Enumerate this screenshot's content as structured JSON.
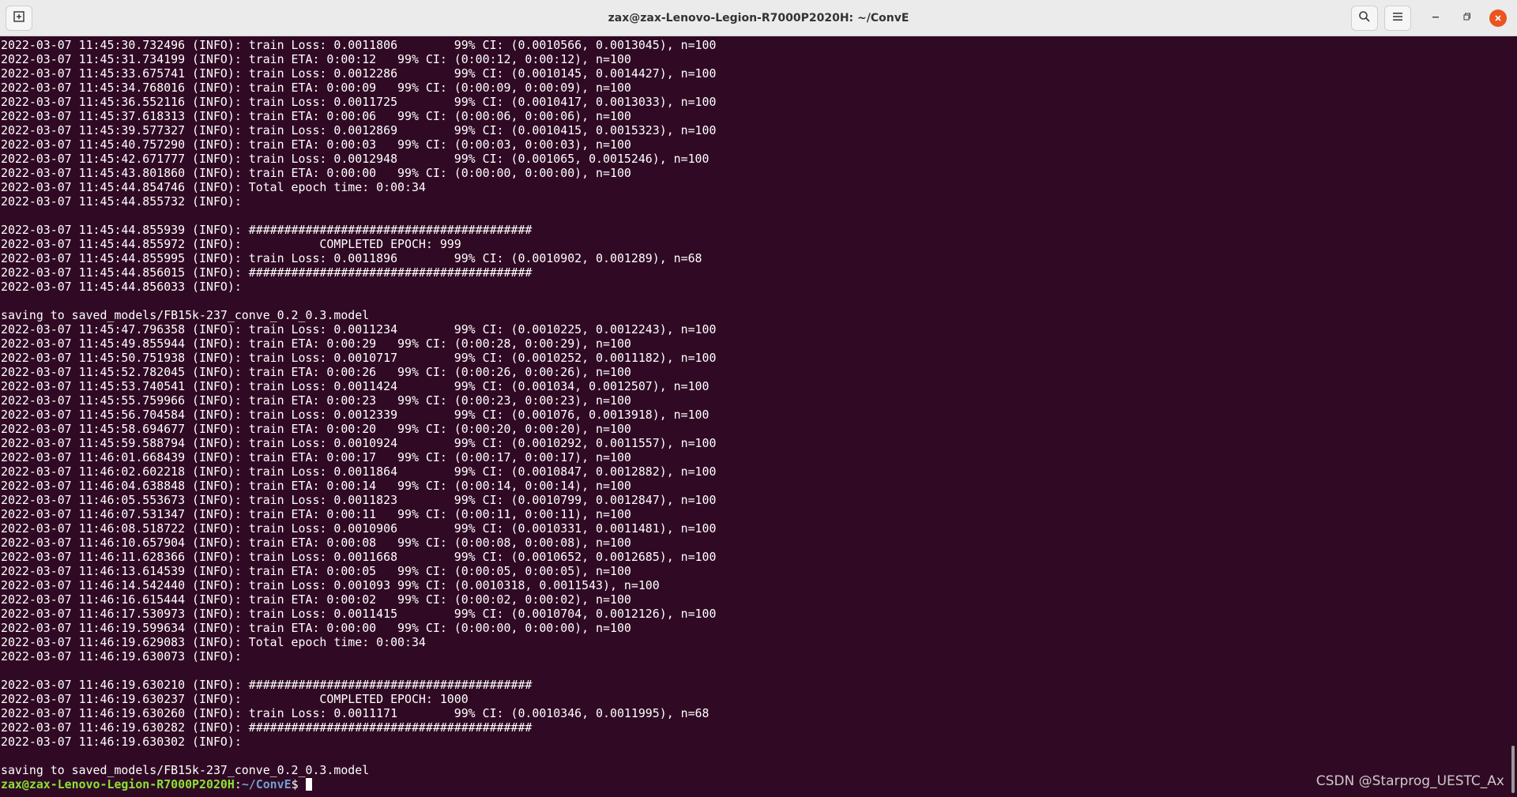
{
  "window": {
    "title": "zax@zax-Lenovo-Legion-R7000P2020H: ~/ConvE"
  },
  "titlebar": {
    "new_tab_icon": "new-tab-icon",
    "search_icon": "search-icon",
    "menu_icon": "hamburger-menu-icon",
    "minimize_icon": "minimize-icon",
    "maximize_icon": "restore-icon",
    "close_icon": "close-icon",
    "close_color": "#e95420"
  },
  "terminal": {
    "background": "#300a24",
    "lines": [
      "2022-03-07 11:45:30.732496 (INFO): train Loss: 0.0011806        99% CI: (0.0010566, 0.0013045), n=100",
      "2022-03-07 11:45:31.734199 (INFO): train ETA: 0:00:12   99% CI: (0:00:12, 0:00:12), n=100",
      "2022-03-07 11:45:33.675741 (INFO): train Loss: 0.0012286        99% CI: (0.0010145, 0.0014427), n=100",
      "2022-03-07 11:45:34.768016 (INFO): train ETA: 0:00:09   99% CI: (0:00:09, 0:00:09), n=100",
      "2022-03-07 11:45:36.552116 (INFO): train Loss: 0.0011725        99% CI: (0.0010417, 0.0013033), n=100",
      "2022-03-07 11:45:37.618313 (INFO): train ETA: 0:00:06   99% CI: (0:00:06, 0:00:06), n=100",
      "2022-03-07 11:45:39.577327 (INFO): train Loss: 0.0012869        99% CI: (0.0010415, 0.0015323), n=100",
      "2022-03-07 11:45:40.757290 (INFO): train ETA: 0:00:03   99% CI: (0:00:03, 0:00:03), n=100",
      "2022-03-07 11:45:42.671777 (INFO): train Loss: 0.0012948        99% CI: (0.001065, 0.0015246), n=100",
      "2022-03-07 11:45:43.801860 (INFO): train ETA: 0:00:00   99% CI: (0:00:00, 0:00:00), n=100",
      "2022-03-07 11:45:44.854746 (INFO): Total epoch time: 0:00:34",
      "2022-03-07 11:45:44.855732 (INFO): ",
      "",
      "2022-03-07 11:45:44.855939 (INFO): ########################################",
      "2022-03-07 11:45:44.855972 (INFO):           COMPLETED EPOCH: 999",
      "2022-03-07 11:45:44.855995 (INFO): train Loss: 0.0011896        99% CI: (0.0010902, 0.001289), n=68",
      "2022-03-07 11:45:44.856015 (INFO): ########################################",
      "2022-03-07 11:45:44.856033 (INFO): ",
      "",
      "saving to saved_models/FB15k-237_conve_0.2_0.3.model",
      "2022-03-07 11:45:47.796358 (INFO): train Loss: 0.0011234        99% CI: (0.0010225, 0.0012243), n=100",
      "2022-03-07 11:45:49.855944 (INFO): train ETA: 0:00:29   99% CI: (0:00:28, 0:00:29), n=100",
      "2022-03-07 11:45:50.751938 (INFO): train Loss: 0.0010717        99% CI: (0.0010252, 0.0011182), n=100",
      "2022-03-07 11:45:52.782045 (INFO): train ETA: 0:00:26   99% CI: (0:00:26, 0:00:26), n=100",
      "2022-03-07 11:45:53.740541 (INFO): train Loss: 0.0011424        99% CI: (0.001034, 0.0012507), n=100",
      "2022-03-07 11:45:55.759966 (INFO): train ETA: 0:00:23   99% CI: (0:00:23, 0:00:23), n=100",
      "2022-03-07 11:45:56.704584 (INFO): train Loss: 0.0012339        99% CI: (0.001076, 0.0013918), n=100",
      "2022-03-07 11:45:58.694677 (INFO): train ETA: 0:00:20   99% CI: (0:00:20, 0:00:20), n=100",
      "2022-03-07 11:45:59.588794 (INFO): train Loss: 0.0010924        99% CI: (0.0010292, 0.0011557), n=100",
      "2022-03-07 11:46:01.668439 (INFO): train ETA: 0:00:17   99% CI: (0:00:17, 0:00:17), n=100",
      "2022-03-07 11:46:02.602218 (INFO): train Loss: 0.0011864        99% CI: (0.0010847, 0.0012882), n=100",
      "2022-03-07 11:46:04.638848 (INFO): train ETA: 0:00:14   99% CI: (0:00:14, 0:00:14), n=100",
      "2022-03-07 11:46:05.553673 (INFO): train Loss: 0.0011823        99% CI: (0.0010799, 0.0012847), n=100",
      "2022-03-07 11:46:07.531347 (INFO): train ETA: 0:00:11   99% CI: (0:00:11, 0:00:11), n=100",
      "2022-03-07 11:46:08.518722 (INFO): train Loss: 0.0010906        99% CI: (0.0010331, 0.0011481), n=100",
      "2022-03-07 11:46:10.657904 (INFO): train ETA: 0:00:08   99% CI: (0:00:08, 0:00:08), n=100",
      "2022-03-07 11:46:11.628366 (INFO): train Loss: 0.0011668        99% CI: (0.0010652, 0.0012685), n=100",
      "2022-03-07 11:46:13.614539 (INFO): train ETA: 0:00:05   99% CI: (0:00:05, 0:00:05), n=100",
      "2022-03-07 11:46:14.542440 (INFO): train Loss: 0.001093 99% CI: (0.0010318, 0.0011543), n=100",
      "2022-03-07 11:46:16.615444 (INFO): train ETA: 0:00:02   99% CI: (0:00:02, 0:00:02), n=100",
      "2022-03-07 11:46:17.530973 (INFO): train Loss: 0.0011415        99% CI: (0.0010704, 0.0012126), n=100",
      "2022-03-07 11:46:19.599634 (INFO): train ETA: 0:00:00   99% CI: (0:00:00, 0:00:00), n=100",
      "2022-03-07 11:46:19.629083 (INFO): Total epoch time: 0:00:34",
      "2022-03-07 11:46:19.630073 (INFO): ",
      "",
      "2022-03-07 11:46:19.630210 (INFO): ########################################",
      "2022-03-07 11:46:19.630237 (INFO):           COMPLETED EPOCH: 1000",
      "2022-03-07 11:46:19.630260 (INFO): train Loss: 0.0011171        99% CI: (0.0010346, 0.0011995), n=68",
      "2022-03-07 11:46:19.630282 (INFO): ########################################",
      "2022-03-07 11:46:19.630302 (INFO): ",
      "",
      "saving to saved_models/FB15k-237_conve_0.2_0.3.model"
    ],
    "prompt": {
      "user_host": "zax@zax-Lenovo-Legion-R7000P2020H",
      "separator": ":",
      "path": "~/ConvE",
      "symbol": "$ "
    }
  },
  "watermark": "CSDN @Starprog_UESTC_Ax"
}
